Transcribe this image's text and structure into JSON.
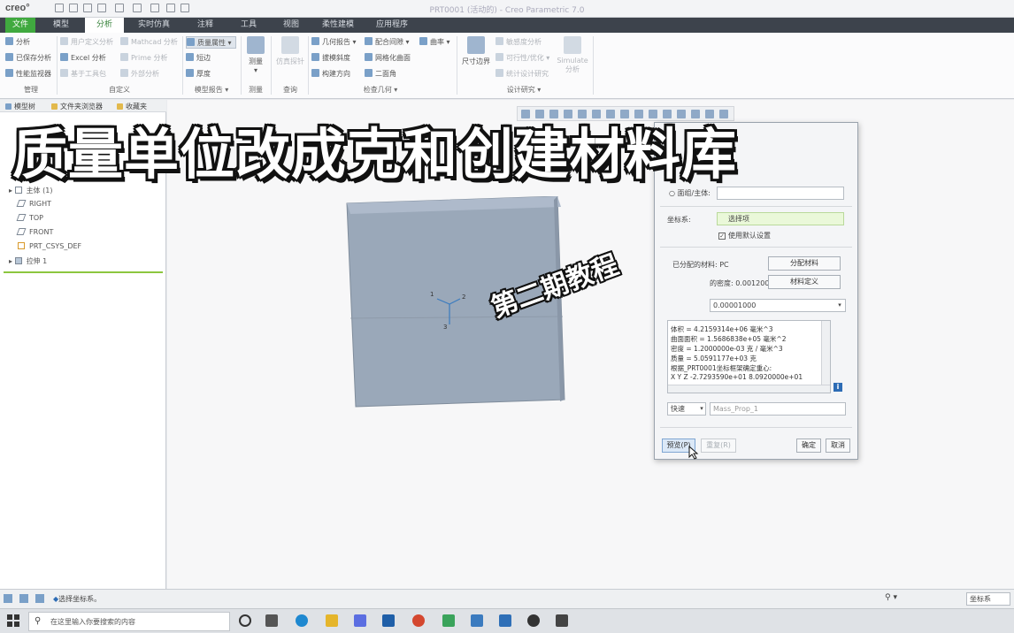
{
  "window": {
    "logo": "creo°",
    "title": "PRT0001 (活动的) - Creo Parametric 7.0"
  },
  "tabs": [
    "文件",
    "模型",
    "分析",
    "实时仿真",
    "注释",
    "工具",
    "视图",
    "柔性建模",
    "应用程序"
  ],
  "ribbon": {
    "manage": {
      "items": [
        "分析",
        "已保存分析",
        "性能监视器"
      ],
      "group": "管理"
    },
    "custom": {
      "items": [
        "用户定义分析",
        "Excel 分析",
        "基于工具包",
        "Mathcad 分析",
        "Prime 分析",
        "外部分析"
      ],
      "group": "自定义"
    },
    "model_report": {
      "items": [
        "质量属性",
        "短边",
        "厚度"
      ],
      "group": "模型报告"
    },
    "measure": {
      "label": "测量",
      "group": "测量"
    },
    "query": {
      "label": "仿真探针",
      "group": "查询"
    },
    "inspect": {
      "items": [
        "几何报告",
        "拔模斜度",
        "构建方向",
        "配合间隙",
        "网格化曲面",
        "二面角",
        "曲率"
      ],
      "group": "检查几何"
    },
    "design": {
      "dim": "尺寸边界",
      "items": [
        "敏感度分析",
        "可行性/优化",
        "统计设计研究"
      ],
      "simulate": "Simulate 分析",
      "group": "设计研究"
    }
  },
  "left_panel": {
    "tabs": [
      "模型树",
      "文件夹浏览器",
      "收藏夹"
    ],
    "tree": [
      "主体 (1)",
      "RIGHT",
      "TOP",
      "FRONT",
      "PRT_CSYS_DEF",
      "拉伸 1"
    ]
  },
  "dialog": {
    "radio_label": "面组/主体:",
    "csys_label": "坐标系:",
    "csys_value": "选择项",
    "use_default": "使用默认设置",
    "assigned_material_label": "已分配的材料: PC",
    "assign_material_btn": "分配材料",
    "density_label": "的密度: 0.001200",
    "material_def_btn": "材料定义",
    "accuracy_value": "0.00001000",
    "results": [
      "体积 =  4.2159314e+06  毫米^3",
      "曲面面积 =  1.5686838e+05  毫米^2",
      "密度 =  1.2000000e-03 克 / 毫米^3",
      "质量 =  5.0591177e+03 克",
      "根据_PRT0001坐标框架确定重心:",
      "X   Y   Z     -2.7293590e+01   8.0920000e+01"
    ],
    "mode": "快速",
    "feature_name": "Mass_Prop_1",
    "preview_btn": "预览(P)",
    "repaint_btn": "重复(R)",
    "ok_btn": "确定",
    "cancel_btn": "取消"
  },
  "status": {
    "message": "选择坐标系。",
    "right_field": "坐标系"
  },
  "taskbar": {
    "search_placeholder": "在这里输入你要搜索的内容"
  },
  "overlay": {
    "title": "质量单位改成克和创建材料库",
    "subtitle": "第二期教程"
  }
}
